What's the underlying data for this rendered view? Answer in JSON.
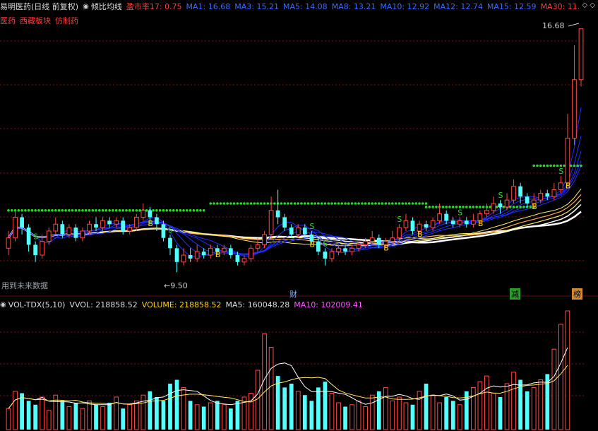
{
  "header": {
    "stock_title": "易明医药(日线 前复权)",
    "indicator_name": "倾比均线",
    "pe": "盈市率17: 0.75",
    "ma1": "MA1: 16.68",
    "ma3": "MA3: 15.21",
    "ma5": "MA5: 14.08",
    "ma8": "MA8: 13.21",
    "ma10": "MA10: 12.92",
    "ma12": "MA12: 12.74",
    "ma15": "MA15: 12.59",
    "ma30": "MA30: 11.",
    "controls": "◇ ◇"
  },
  "tags": [
    "医药",
    "西藏板块",
    "仿制药"
  ],
  "annotations": {
    "future_note": "用到未来数据",
    "price_low": "←9.50",
    "price_high": "16.68",
    "event_cai": "财",
    "event_jian": "减",
    "event_bang": "榜",
    "signal_b": "B",
    "signal_s": "S"
  },
  "volume_header": {
    "name": "VOL-TDX(5,10)",
    "vvol": "VVOL: 218858.52",
    "volume": "VOLUME: 218858.52",
    "ma5": "MA5: 160048.28",
    "ma10": "MA10: 102009.41"
  },
  "colors": {
    "up": "#ff4a4a",
    "down": "#54ffff",
    "dots": "#22dd22",
    "ma_blue": "#2030ff",
    "ma_white": "#ffffff",
    "ma_yellow": "#ffee66",
    "ma_orange": "#ffaa55",
    "ma5_vol": "#ffffff",
    "ma10_vol": "#ffee66"
  },
  "chart_data": {
    "type": "candlestick",
    "price_range": [
      9.5,
      16.68
    ],
    "candles": [
      {
        "o": 10.3,
        "c": 10.6,
        "h": 10.8,
        "l": 10.1
      },
      {
        "o": 10.6,
        "c": 11.2,
        "h": 11.4,
        "l": 10.5
      },
      {
        "o": 11.2,
        "c": 10.9,
        "h": 11.3,
        "l": 10.7
      },
      {
        "o": 10.9,
        "c": 10.4,
        "h": 11.0,
        "l": 10.2
      },
      {
        "o": 10.4,
        "c": 10.1,
        "h": 10.5,
        "l": 9.9
      },
      {
        "o": 10.1,
        "c": 10.5,
        "h": 10.7,
        "l": 10.0
      },
      {
        "o": 10.5,
        "c": 10.8,
        "h": 10.9,
        "l": 10.4
      },
      {
        "o": 10.8,
        "c": 11.0,
        "h": 11.2,
        "l": 10.7
      },
      {
        "o": 11.0,
        "c": 10.7,
        "h": 11.1,
        "l": 10.6
      },
      {
        "o": 10.7,
        "c": 10.9,
        "h": 11.0,
        "l": 10.6
      },
      {
        "o": 10.9,
        "c": 10.6,
        "h": 11.0,
        "l": 10.5
      },
      {
        "o": 10.6,
        "c": 10.8,
        "h": 10.9,
        "l": 10.5
      },
      {
        "o": 10.8,
        "c": 11.0,
        "h": 11.1,
        "l": 10.7
      },
      {
        "o": 11.0,
        "c": 10.9,
        "h": 11.2,
        "l": 10.8
      },
      {
        "o": 10.9,
        "c": 11.1,
        "h": 11.2,
        "l": 10.8
      },
      {
        "o": 11.1,
        "c": 11.0,
        "h": 11.2,
        "l": 10.9
      },
      {
        "o": 11.0,
        "c": 11.1,
        "h": 11.2,
        "l": 10.9
      },
      {
        "o": 11.1,
        "c": 10.8,
        "h": 11.2,
        "l": 10.7
      },
      {
        "o": 10.8,
        "c": 10.9,
        "h": 11.0,
        "l": 10.7
      },
      {
        "o": 10.9,
        "c": 11.2,
        "h": 11.3,
        "l": 10.8
      },
      {
        "o": 11.2,
        "c": 11.4,
        "h": 11.6,
        "l": 11.1
      },
      {
        "o": 11.4,
        "c": 11.2,
        "h": 11.5,
        "l": 11.0
      },
      {
        "o": 11.2,
        "c": 11.0,
        "h": 11.3,
        "l": 10.8
      },
      {
        "o": 11.0,
        "c": 10.6,
        "h": 11.1,
        "l": 10.5
      },
      {
        "o": 10.6,
        "c": 10.3,
        "h": 10.7,
        "l": 10.1
      },
      {
        "o": 10.3,
        "c": 9.9,
        "h": 10.4,
        "l": 9.6
      },
      {
        "o": 9.9,
        "c": 10.1,
        "h": 10.3,
        "l": 9.8
      },
      {
        "o": 10.1,
        "c": 10.0,
        "h": 10.3,
        "l": 9.9
      },
      {
        "o": 10.0,
        "c": 10.2,
        "h": 10.4,
        "l": 9.9
      },
      {
        "o": 10.2,
        "c": 10.1,
        "h": 10.3,
        "l": 10.0
      },
      {
        "o": 10.1,
        "c": 10.3,
        "h": 10.4,
        "l": 10.0
      },
      {
        "o": 10.3,
        "c": 10.2,
        "h": 10.4,
        "l": 10.1
      },
      {
        "o": 10.2,
        "c": 10.3,
        "h": 10.4,
        "l": 10.1
      },
      {
        "o": 10.3,
        "c": 10.1,
        "h": 10.4,
        "l": 10.0
      },
      {
        "o": 10.1,
        "c": 9.9,
        "h": 10.2,
        "l": 9.8
      },
      {
        "o": 9.9,
        "c": 10.0,
        "h": 10.1,
        "l": 9.8
      },
      {
        "o": 10.0,
        "c": 10.3,
        "h": 10.4,
        "l": 9.9
      },
      {
        "o": 10.3,
        "c": 10.4,
        "h": 10.6,
        "l": 10.2
      },
      {
        "o": 10.4,
        "c": 10.7,
        "h": 10.8,
        "l": 10.3
      },
      {
        "o": 10.7,
        "c": 11.4,
        "h": 11.8,
        "l": 10.6
      },
      {
        "o": 11.4,
        "c": 11.2,
        "h": 12.0,
        "l": 11.0
      },
      {
        "o": 11.2,
        "c": 10.9,
        "h": 11.3,
        "l": 10.8
      },
      {
        "o": 10.9,
        "c": 10.7,
        "h": 11.0,
        "l": 10.6
      },
      {
        "o": 10.7,
        "c": 10.9,
        "h": 11.0,
        "l": 10.6
      },
      {
        "o": 10.9,
        "c": 10.7,
        "h": 11.0,
        "l": 10.6
      },
      {
        "o": 10.7,
        "c": 10.5,
        "h": 10.8,
        "l": 10.4
      },
      {
        "o": 10.5,
        "c": 10.2,
        "h": 10.6,
        "l": 10.1
      },
      {
        "o": 10.2,
        "c": 10.0,
        "h": 10.3,
        "l": 9.8
      },
      {
        "o": 10.0,
        "c": 10.2,
        "h": 10.3,
        "l": 9.9
      },
      {
        "o": 10.2,
        "c": 10.3,
        "h": 10.4,
        "l": 10.1
      },
      {
        "o": 10.3,
        "c": 10.2,
        "h": 10.4,
        "l": 10.1
      },
      {
        "o": 10.2,
        "c": 10.3,
        "h": 10.4,
        "l": 10.1
      },
      {
        "o": 10.3,
        "c": 10.4,
        "h": 10.5,
        "l": 10.2
      },
      {
        "o": 10.4,
        "c": 10.5,
        "h": 10.6,
        "l": 10.3
      },
      {
        "o": 10.5,
        "c": 10.6,
        "h": 10.8,
        "l": 10.4
      },
      {
        "o": 10.6,
        "c": 10.4,
        "h": 10.7,
        "l": 10.3
      },
      {
        "o": 10.4,
        "c": 10.5,
        "h": 10.6,
        "l": 10.3
      },
      {
        "o": 10.5,
        "c": 10.6,
        "h": 10.8,
        "l": 10.4
      },
      {
        "o": 10.6,
        "c": 10.9,
        "h": 11.0,
        "l": 10.5
      },
      {
        "o": 10.9,
        "c": 11.1,
        "h": 11.3,
        "l": 10.8
      },
      {
        "o": 11.1,
        "c": 10.8,
        "h": 11.2,
        "l": 10.7
      },
      {
        "o": 10.8,
        "c": 11.0,
        "h": 11.1,
        "l": 10.7
      },
      {
        "o": 11.0,
        "c": 10.9,
        "h": 11.1,
        "l": 10.8
      },
      {
        "o": 10.9,
        "c": 11.1,
        "h": 11.2,
        "l": 10.8
      },
      {
        "o": 11.1,
        "c": 11.3,
        "h": 11.6,
        "l": 11.0
      },
      {
        "o": 11.3,
        "c": 11.1,
        "h": 11.4,
        "l": 11.0
      },
      {
        "o": 11.1,
        "c": 11.0,
        "h": 11.2,
        "l": 10.9
      },
      {
        "o": 11.0,
        "c": 11.1,
        "h": 11.2,
        "l": 10.9
      },
      {
        "o": 11.1,
        "c": 11.0,
        "h": 11.2,
        "l": 10.9
      },
      {
        "o": 11.0,
        "c": 11.1,
        "h": 11.3,
        "l": 10.9
      },
      {
        "o": 11.1,
        "c": 11.3,
        "h": 11.4,
        "l": 11.0
      },
      {
        "o": 11.3,
        "c": 11.4,
        "h": 11.6,
        "l": 11.2
      },
      {
        "o": 11.4,
        "c": 11.6,
        "h": 11.8,
        "l": 11.3
      },
      {
        "o": 11.6,
        "c": 11.5,
        "h": 11.7,
        "l": 11.3
      },
      {
        "o": 11.5,
        "c": 11.7,
        "h": 11.9,
        "l": 11.4
      },
      {
        "o": 11.7,
        "c": 12.1,
        "h": 12.3,
        "l": 11.6
      },
      {
        "o": 12.1,
        "c": 11.8,
        "h": 12.2,
        "l": 11.6
      },
      {
        "o": 11.8,
        "c": 11.6,
        "h": 11.9,
        "l": 11.5
      },
      {
        "o": 11.6,
        "c": 11.7,
        "h": 11.9,
        "l": 11.5
      },
      {
        "o": 11.7,
        "c": 11.9,
        "h": 12.0,
        "l": 11.6
      },
      {
        "o": 11.9,
        "c": 11.8,
        "h": 12.0,
        "l": 11.7
      },
      {
        "o": 11.8,
        "c": 12.0,
        "h": 12.2,
        "l": 11.7
      },
      {
        "o": 12.0,
        "c": 12.2,
        "h": 12.4,
        "l": 11.9
      },
      {
        "o": 12.2,
        "c": 13.5,
        "h": 14.2,
        "l": 12.1
      },
      {
        "o": 13.5,
        "c": 15.2,
        "h": 16.2,
        "l": 13.3
      },
      {
        "o": 15.2,
        "c": 16.68,
        "h": 16.68,
        "l": 15.0
      }
    ],
    "volume": [
      22,
      40,
      38,
      30,
      26,
      34,
      20,
      36,
      30,
      24,
      28,
      22,
      30,
      26,
      24,
      28,
      34,
      22,
      26,
      30,
      36,
      40,
      34,
      30,
      48,
      52,
      44,
      30,
      26,
      24,
      28,
      30,
      26,
      22,
      30,
      34,
      38,
      62,
      100,
      86,
      56,
      44,
      48,
      40,
      36,
      30,
      44,
      50,
      38,
      28,
      24,
      26,
      30,
      24,
      36,
      40,
      44,
      30,
      34,
      28,
      26,
      40,
      48,
      36,
      28,
      34,
      30,
      26,
      40,
      44,
      50,
      56,
      38,
      34,
      48,
      60,
      52,
      40,
      44,
      52,
      58,
      84,
      110,
      124
    ]
  }
}
